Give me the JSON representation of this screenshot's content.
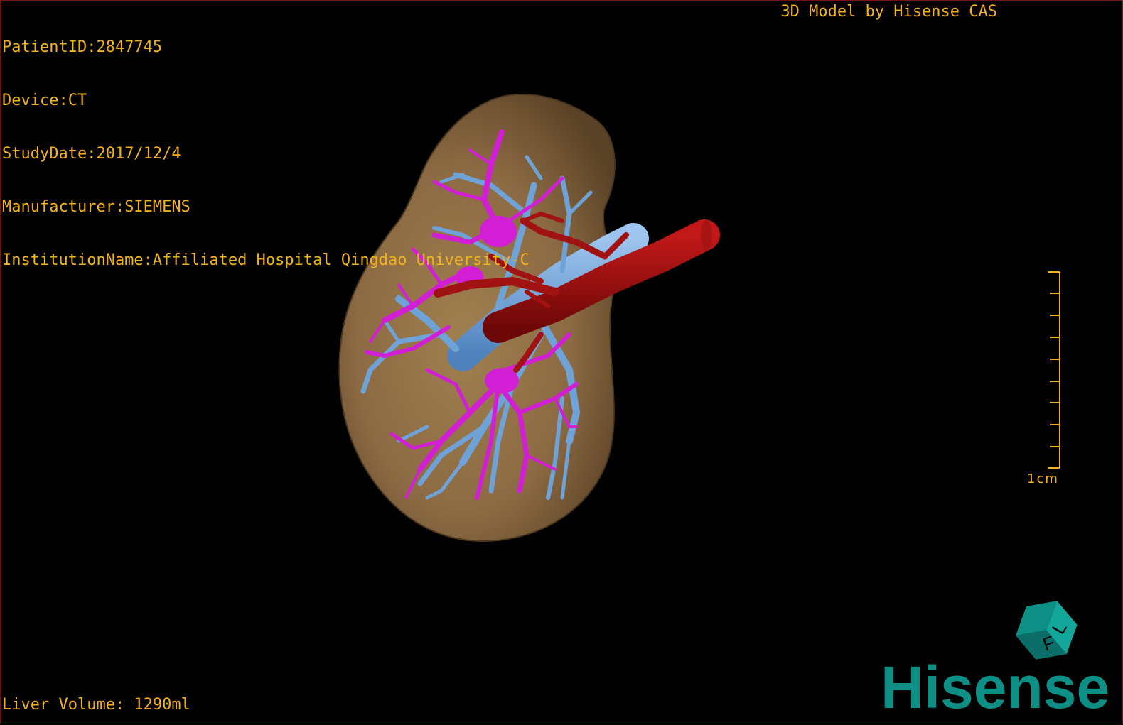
{
  "patient_info": [
    {
      "label": "PatientID:",
      "value": "2847745"
    },
    {
      "label": "Device:",
      "value": "CT"
    },
    {
      "label": "StudyDate:",
      "value": "2017/12/4"
    },
    {
      "label": "Manufacturer:",
      "value": "SIEMENS"
    },
    {
      "label": "InstitutionName:",
      "value": "Affiliated Hospital Qingdao University-C"
    }
  ],
  "viewer_title": "3D Model by Hisense CAS",
  "liver_volume": "Liver Volume: 1290ml",
  "scale_bar": {
    "label": "1cm",
    "tick_count": 10
  },
  "orientation_cube": {
    "face_letters": [
      "F",
      "L"
    ]
  },
  "brand_logo": "Hisense",
  "colors": {
    "overlay_text": "#f2b21b",
    "liver": "#8c6a43",
    "portal_vein": "#6fa3d8",
    "hepatic_vein": "#d21fd6",
    "artery": "#9a0f0f",
    "brand": "#0e8f86"
  },
  "layers": [
    "liver-surface",
    "portal-vein",
    "hepatic-vein",
    "hepatic-artery"
  ]
}
